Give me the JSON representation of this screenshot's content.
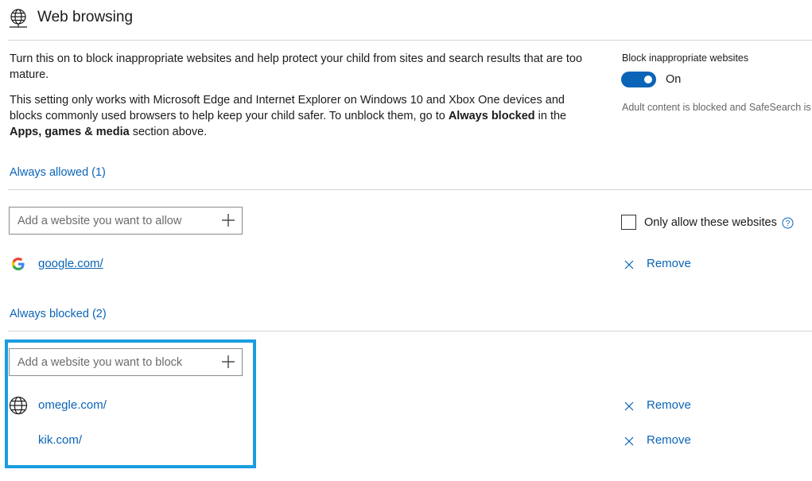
{
  "header": {
    "title": "Web browsing",
    "icon": "globe-icon"
  },
  "intro": {
    "paragraph1": "Turn this on to block inappropriate websites and help protect your child from sites and search results that are too mature.",
    "paragraph2_prefix": "This setting only works with Microsoft Edge and Internet Explorer on Windows 10 and Xbox One devices and blocks commonly used browsers to help keep your child safer. To unblock them, go to ",
    "paragraph2_bold1": "Always blocked",
    "paragraph2_mid": " in the ",
    "paragraph2_bold2": "Apps, games & media",
    "paragraph2_suffix": " section above."
  },
  "block_setting": {
    "label": "Block inappropriate websites",
    "state_label": "On",
    "enabled": true,
    "note": "Adult content is blocked and SafeSearch is"
  },
  "always_allowed": {
    "header": "Always allowed (1)",
    "input_placeholder": "Add a website you want to allow",
    "only_allow_label": "Only allow these websites",
    "only_allow_checked": false,
    "sites": [
      {
        "url": "google.com/",
        "icon": "google-icon",
        "remove_label": "Remove"
      }
    ]
  },
  "always_blocked": {
    "header": "Always blocked (2)",
    "input_placeholder": "Add a website you want to block",
    "sites": [
      {
        "url": "omegle.com/",
        "icon": "globe-icon",
        "remove_label": "Remove"
      },
      {
        "url": "kik.com/",
        "icon": "",
        "remove_label": "Remove"
      }
    ]
  },
  "colors": {
    "accent": "#0a64b8",
    "highlight": "#1a9de0"
  }
}
